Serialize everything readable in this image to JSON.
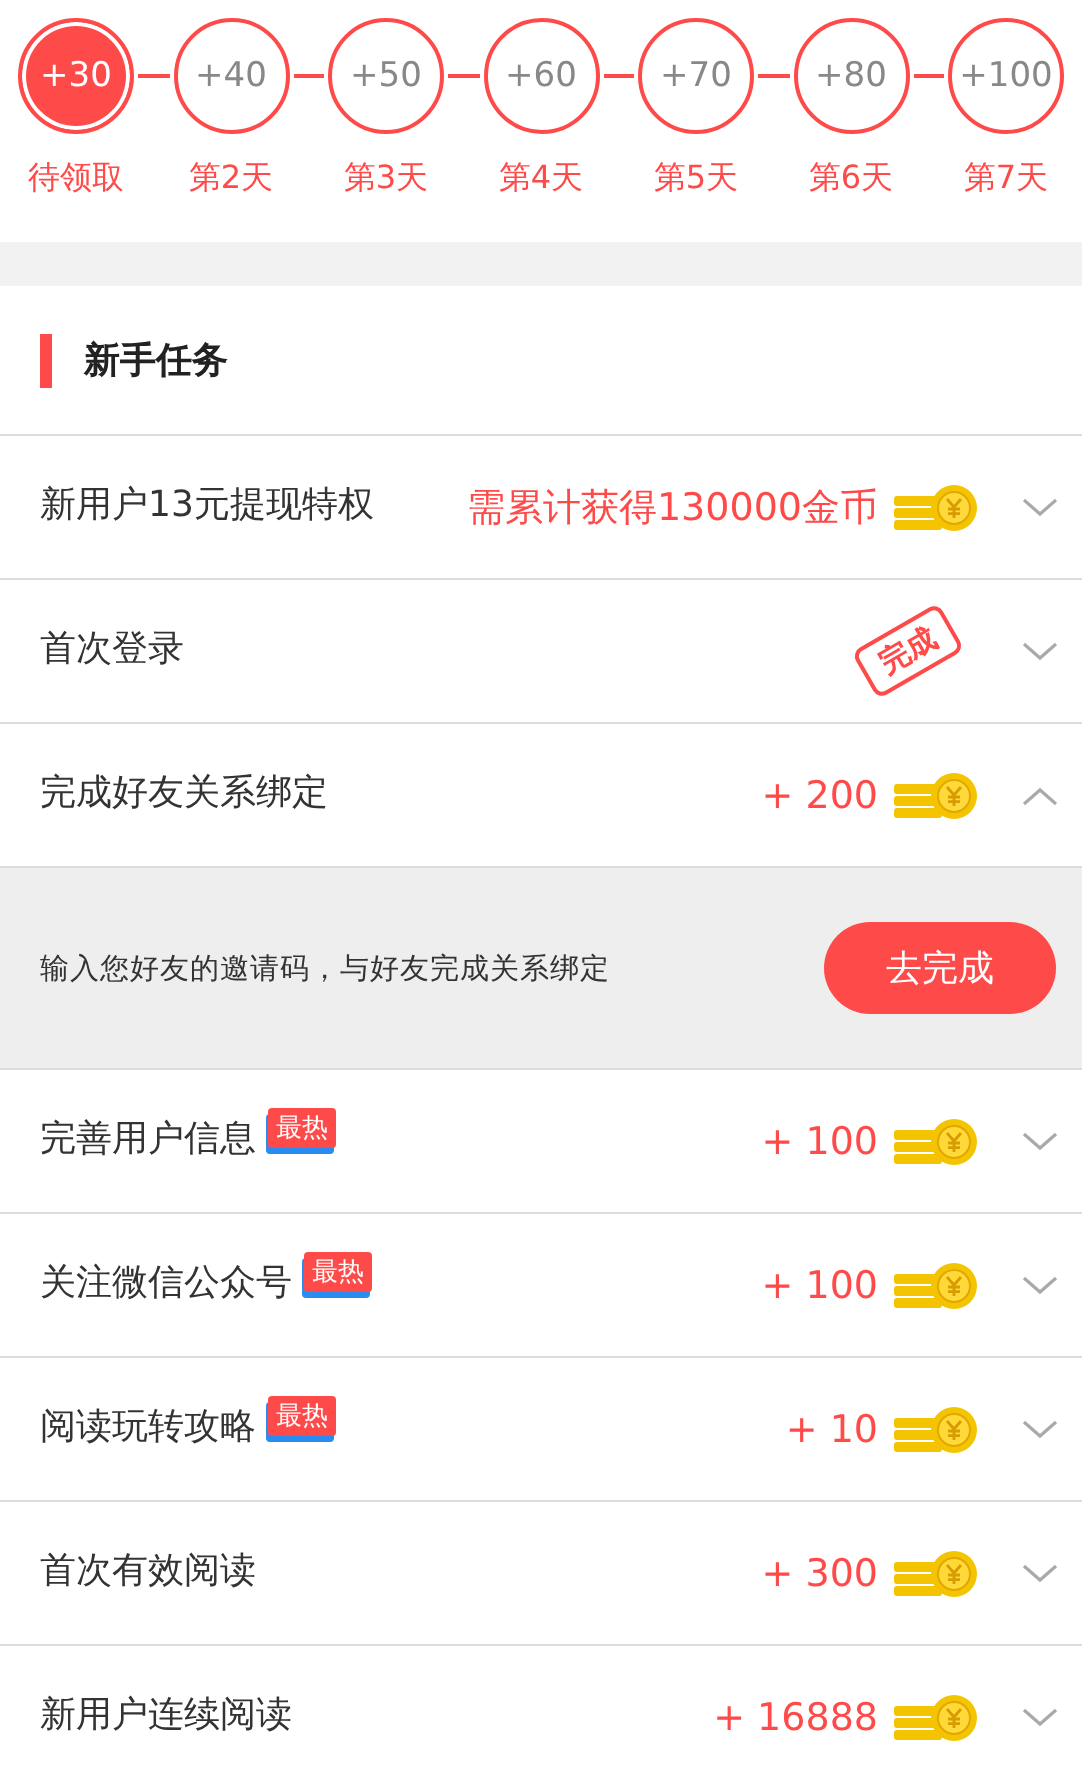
{
  "checkin": [
    {
      "reward": "+30",
      "label": "待领取",
      "selected": true
    },
    {
      "reward": "+40",
      "label": "第2天",
      "selected": false
    },
    {
      "reward": "+50",
      "label": "第3天",
      "selected": false
    },
    {
      "reward": "+60",
      "label": "第4天",
      "selected": false
    },
    {
      "reward": "+70",
      "label": "第5天",
      "selected": false
    },
    {
      "reward": "+80",
      "label": "第6天",
      "selected": false
    },
    {
      "reward": "+100",
      "label": "第7天",
      "selected": false
    }
  ],
  "section": {
    "title": "新手任务"
  },
  "tasks": [
    {
      "kind": "reward",
      "title": "新用户13元提现特权",
      "reward": "需累计获得130000金币",
      "expanded": false
    },
    {
      "kind": "done",
      "title": "首次登录",
      "stamp": "完成",
      "expanded": false
    },
    {
      "kind": "reward",
      "title": "完成好友关系绑定",
      "reward": "+ 200",
      "expanded": true,
      "detail": {
        "text": "输入您好友的邀请码，与好友完成关系绑定",
        "button": "去完成"
      }
    },
    {
      "kind": "reward",
      "title": "完善用户信息",
      "badge": "最热",
      "reward": "+ 100",
      "expanded": false
    },
    {
      "kind": "reward",
      "title": "关注微信公众号",
      "badge": "最热",
      "reward": "+ 100",
      "expanded": false
    },
    {
      "kind": "reward",
      "title": "阅读玩转攻略",
      "badge": "最热",
      "reward": "+ 10",
      "expanded": false
    },
    {
      "kind": "reward",
      "title": "首次有效阅读",
      "reward": "+ 300",
      "expanded": false
    },
    {
      "kind": "reward",
      "title": "新用户连续阅读",
      "reward": "+ 16888",
      "expanded": false
    }
  ]
}
